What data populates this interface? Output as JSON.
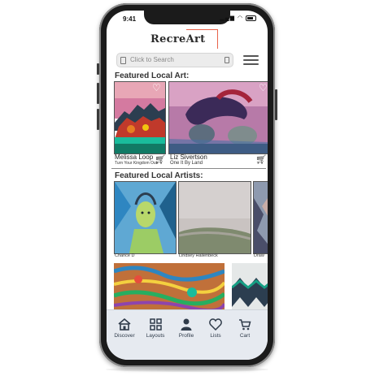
{
  "status_bar": {
    "time": "9:41"
  },
  "header": {
    "logo_text": "RecreArt"
  },
  "search": {
    "placeholder": "Click to Search"
  },
  "featured_art": {
    "title": "Featured Local Art:",
    "items": [
      {
        "artist": "Melissa Loop",
        "artwork": "Turn Your Kingdom Out"
      },
      {
        "artist": "Liz Sivertson",
        "artwork": "One It By Land"
      }
    ]
  },
  "featured_artists": {
    "title": "Featured Local Artists:",
    "items": [
      {
        "name": "Chance D"
      },
      {
        "name": "Lindsey Hallenbeck"
      },
      {
        "name": "Draw"
      }
    ]
  },
  "tabs": [
    {
      "label": "Discover",
      "icon": "home-icon"
    },
    {
      "label": "Layouts",
      "icon": "grid-icon"
    },
    {
      "label": "Profile",
      "icon": "person-icon"
    },
    {
      "label": "Lists",
      "icon": "heart-icon"
    },
    {
      "label": "Cart",
      "icon": "cart-icon"
    }
  ],
  "colors": {
    "logo_accent": "#e8634a",
    "tabbar_bg": "#e6eaf0"
  }
}
